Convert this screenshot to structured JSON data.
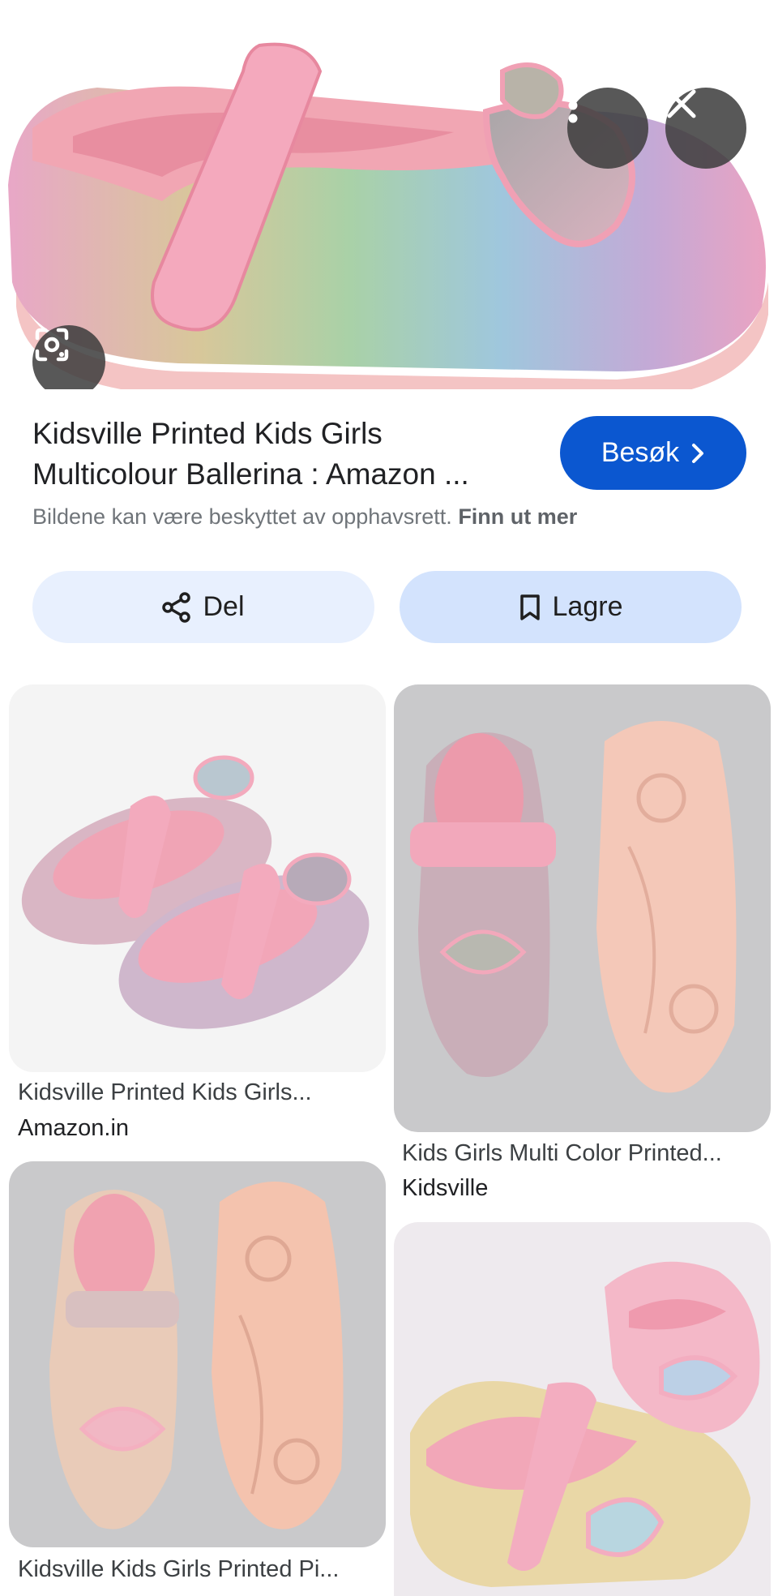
{
  "hero": {
    "menu_icon": "more-vert-icon",
    "close_icon": "close-icon",
    "lens_icon": "lens-camera-icon"
  },
  "result": {
    "title_line1": "Kidsville Printed Kids Girls",
    "title_line2": "Multicolour Ballerina : Amazon ...",
    "visit_label": "Besøk",
    "copyright_text": "Bildene kan være beskyttet av opphavsrett.",
    "learn_more": "Finn ut mer"
  },
  "actions": {
    "share_label": "Del",
    "save_label": "Lagre"
  },
  "related": [
    {
      "caption": "Kidsville Printed Kids Girls...",
      "source": "Amazon.in"
    },
    {
      "caption": "Kids Girls Multi Color Printed...",
      "source": "Kidsville"
    },
    {
      "caption": "Kidsville Kids Girls Printed Pi...",
      "source": ""
    },
    {
      "caption": "",
      "source": ""
    }
  ],
  "colors": {
    "accent": "#0b57d0",
    "share_bg": "#e8f0fe",
    "save_bg": "#d3e3fd",
    "shoe_pink": "#f2a8bd",
    "sole_peach": "#f6c7b6"
  }
}
